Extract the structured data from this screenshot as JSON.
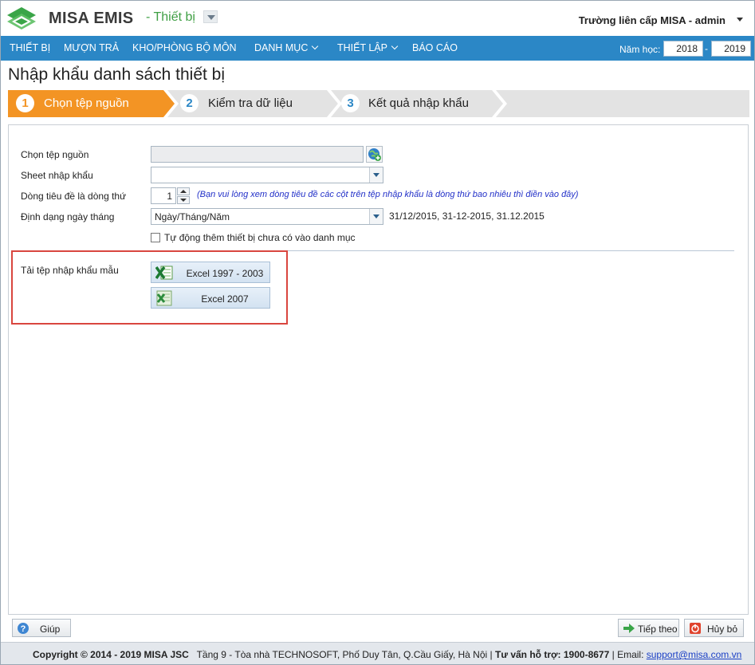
{
  "header": {
    "brand": "MISA EMIS",
    "module": "- Thiết bị",
    "user": "Trường liên cấp MISA - admin"
  },
  "nav": {
    "items": [
      {
        "label": "THIẾT BỊ",
        "dropdown": false
      },
      {
        "label": "MƯỢN TRẢ",
        "dropdown": false
      },
      {
        "label": "KHO/PHÒNG BỘ MÔN",
        "dropdown": false
      },
      {
        "label": "DANH MỤC",
        "dropdown": true
      },
      {
        "label": "THIẾT LẬP",
        "dropdown": true
      },
      {
        "label": "BÁO CÁO",
        "dropdown": false
      }
    ],
    "school_year_label": "Năm học:",
    "year_from": "2018",
    "year_separator": "-",
    "year_to": "2019"
  },
  "page": {
    "title": "Nhập khẩu danh sách thiết bị"
  },
  "steps": [
    {
      "number": "1",
      "label": "Chọn tệp nguồn",
      "active": true
    },
    {
      "number": "2",
      "label": "Kiểm tra dữ liệu",
      "active": false
    },
    {
      "number": "3",
      "label": "Kết quả nhập khẩu",
      "active": false
    }
  ],
  "form": {
    "source_file_label": "Chọn tệp nguồn",
    "source_file_value": "",
    "sheet_label": "Sheet nhập khẩu",
    "sheet_value": "",
    "header_row_label": "Dòng tiêu đề là dòng thứ",
    "header_row_value": "1",
    "header_row_hint": "(Bạn vui lòng xem dòng tiêu đề các cột trên tệp nhập khẩu là dòng thứ bao nhiêu thì điền vào đây)",
    "date_format_label": "Định dạng ngày tháng",
    "date_format_value": "Ngày/Tháng/Năm",
    "date_format_example": "31/12/2015, 31-12-2015, 31.12.2015",
    "auto_add_label": "Tự động thêm thiết bị chưa có vào danh mục",
    "auto_add_checked": false
  },
  "templates": {
    "label": "Tải tệp nhập khẩu mẫu",
    "excel_2003": "Excel 1997 - 2003",
    "excel_2007": "Excel 2007"
  },
  "buttons": {
    "help": "Giúp",
    "next": "Tiếp theo",
    "cancel": "Hủy bỏ"
  },
  "footer": {
    "copyright": "Copyright © 2014 - 2019 MISA JSC",
    "address": "Tầng 9 - Tòa nhà TECHNOSOFT, Phố Duy Tân, Q.Cầu Giấy, Hà Nội",
    "hotline": "Tư vấn hỗ trợ: 1900-8677",
    "email_label": "Email:",
    "email": "support@misa.com.vn"
  },
  "colors": {
    "nav": "#2b87c6",
    "step_active": "#f39424",
    "step_inactive": "#e3e3e3",
    "highlight_box": "#d9463f",
    "brand_green": "#3f9f44"
  }
}
